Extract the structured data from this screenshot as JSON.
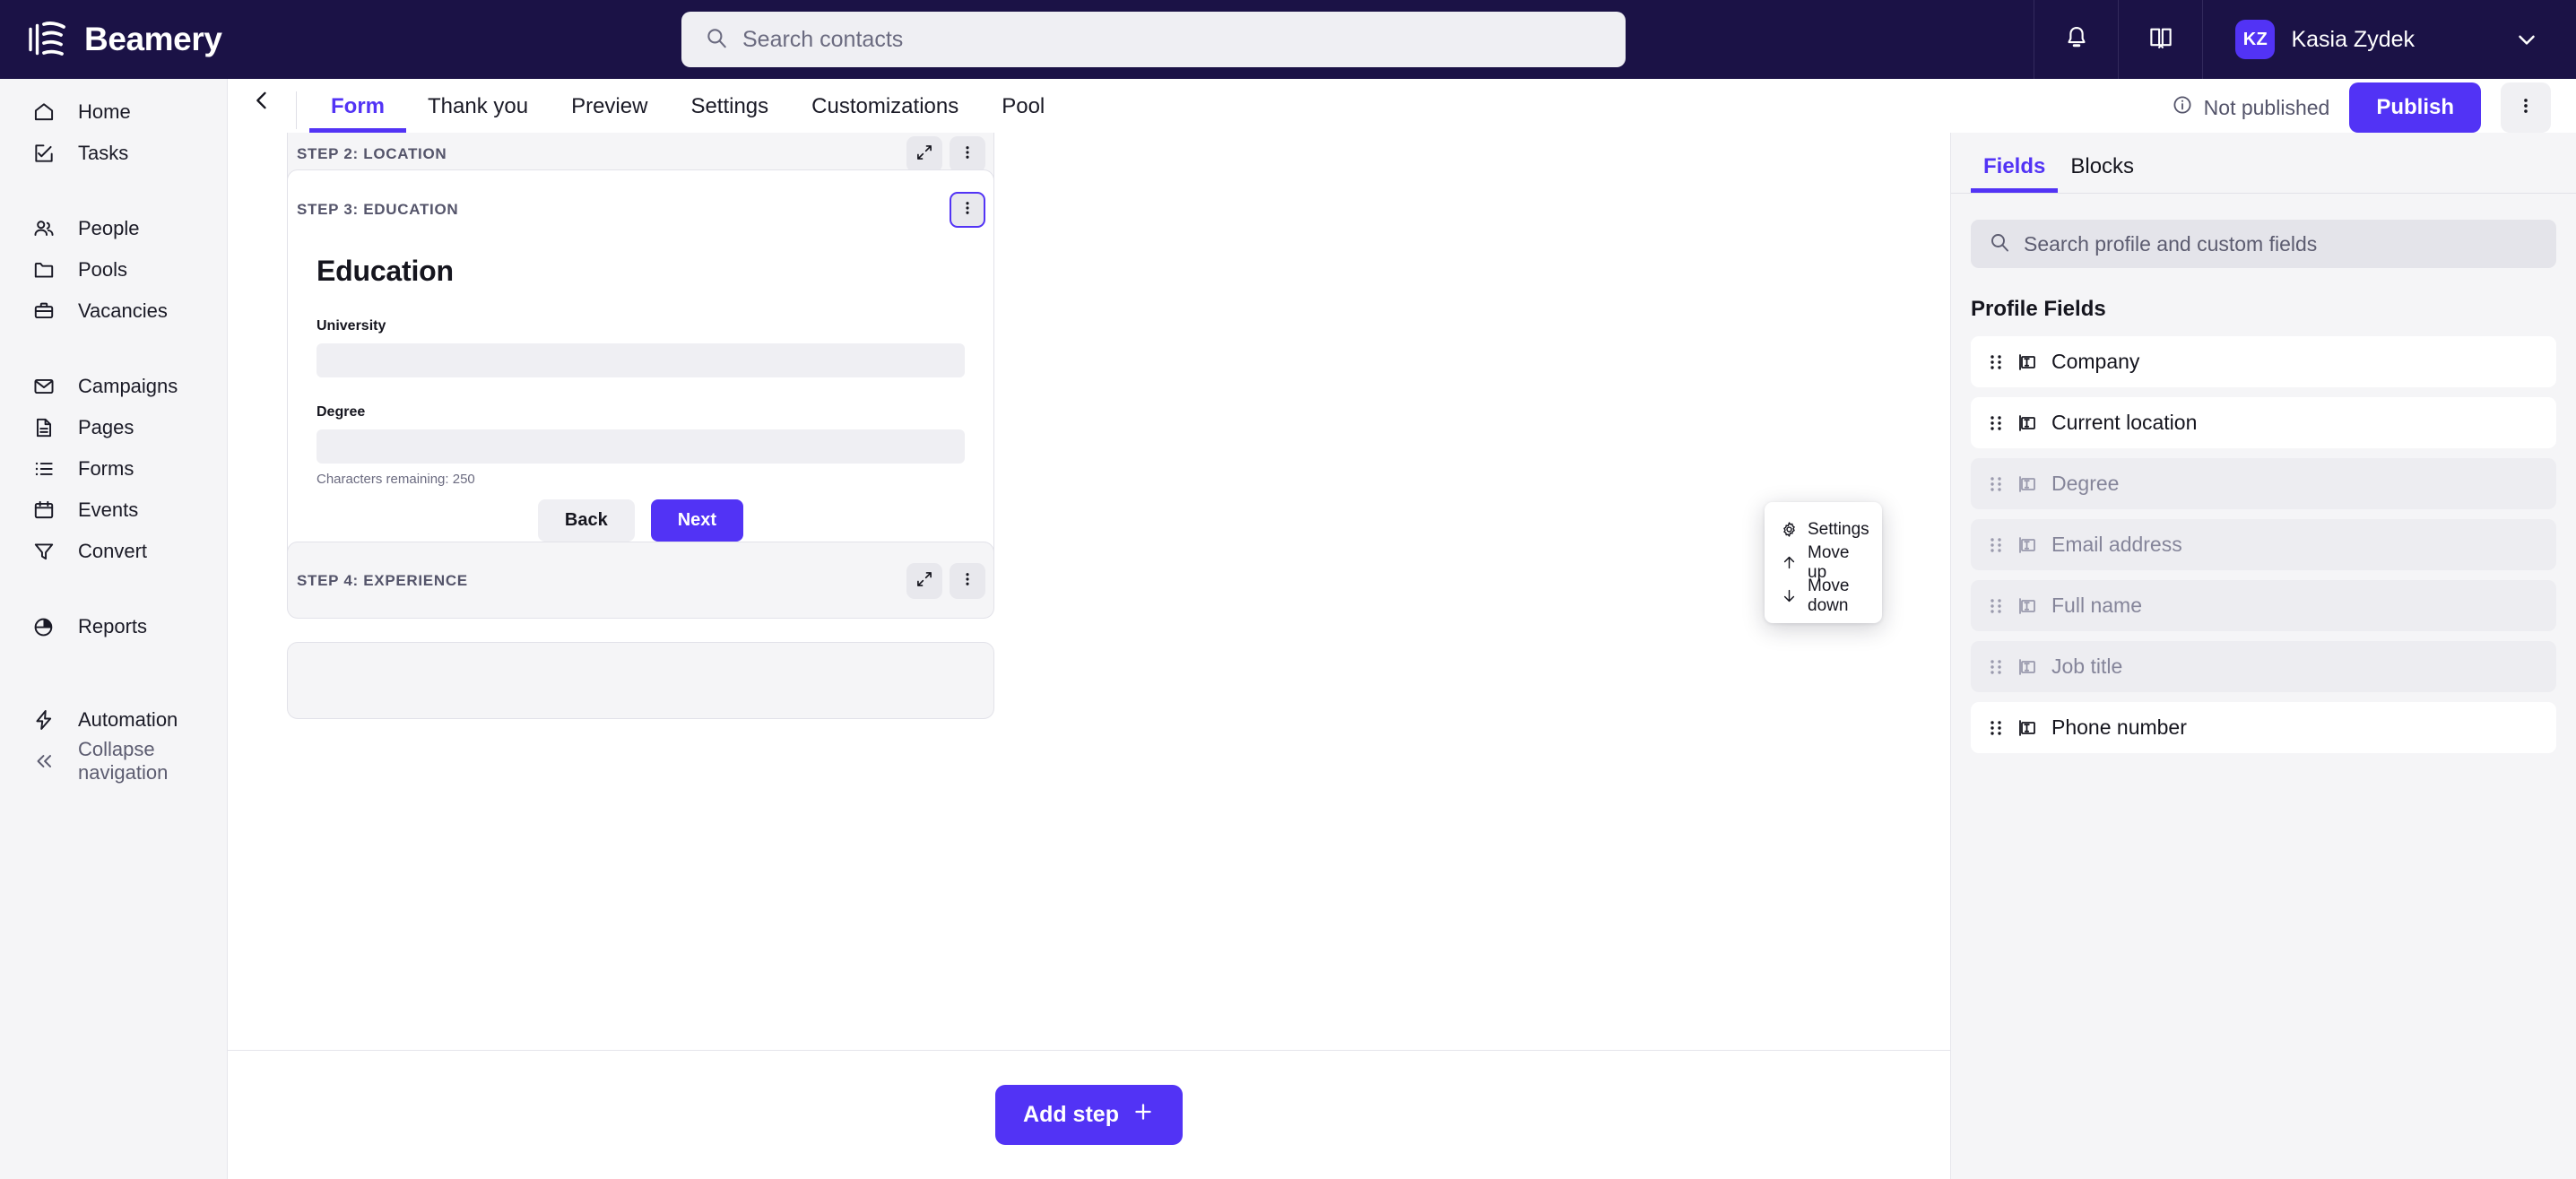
{
  "brand": {
    "name": "Beamery",
    "accent": "#5233F5",
    "topbar_bg": "#1B1246"
  },
  "topbar": {
    "search_placeholder": "Search contacts",
    "notifications_icon": "bell-icon",
    "knowledge_icon": "book-icon",
    "user": {
      "initials": "KZ",
      "name": "Kasia Zydek"
    }
  },
  "sidebar": {
    "groups": [
      {
        "items": [
          {
            "label": "Home",
            "icon": "home-icon"
          },
          {
            "label": "Tasks",
            "icon": "task-check-icon"
          }
        ]
      },
      {
        "items": [
          {
            "label": "People",
            "icon": "people-icon"
          },
          {
            "label": "Pools",
            "icon": "folder-icon"
          },
          {
            "label": "Vacancies",
            "icon": "briefcase-icon"
          }
        ]
      },
      {
        "items": [
          {
            "label": "Campaigns",
            "icon": "envelope-icon"
          },
          {
            "label": "Pages",
            "icon": "document-icon"
          },
          {
            "label": "Forms",
            "icon": "list-icon"
          },
          {
            "label": "Events",
            "icon": "calendar-icon"
          },
          {
            "label": "Convert",
            "icon": "funnel-icon"
          }
        ]
      },
      {
        "items": [
          {
            "label": "Reports",
            "icon": "pie-chart-icon"
          }
        ]
      },
      {
        "items": [
          {
            "label": "Automation",
            "icon": "lightning-icon"
          },
          {
            "label": "Collapse navigation",
            "icon": "double-chevron-left-icon"
          }
        ]
      }
    ]
  },
  "tabbar": {
    "back_icon": "chevron-left-icon",
    "tabs": [
      {
        "label": "Form",
        "active": true
      },
      {
        "label": "Thank you",
        "active": false
      },
      {
        "label": "Preview",
        "active": false
      },
      {
        "label": "Settings",
        "active": false
      },
      {
        "label": "Customizations",
        "active": false
      },
      {
        "label": "Pool",
        "active": false
      }
    ],
    "status_label": "Not published",
    "status_icon": "info-icon",
    "publish_label": "Publish",
    "overflow_icon": "kebab-icon"
  },
  "canvas": {
    "steps": [
      {
        "title": "STEP 2: LOCATION",
        "state": "collapsed",
        "buttons": [
          "expand-icon",
          "kebab-icon"
        ]
      },
      {
        "title": "STEP 3: EDUCATION",
        "state": "expanded",
        "buttons": [
          "kebab-icon"
        ]
      },
      {
        "title": "STEP 4: EXPERIENCE",
        "state": "collapsed",
        "buttons": [
          "expand-icon",
          "kebab-icon"
        ]
      }
    ],
    "education_form": {
      "heading": "Education",
      "fields": [
        {
          "label": "University",
          "value": "",
          "hint": ""
        },
        {
          "label": "Degree",
          "value": "",
          "hint": "Characters remaining: 250"
        }
      ],
      "back_label": "Back",
      "next_label": "Next"
    },
    "step_menu": {
      "items": [
        {
          "label": "Settings",
          "icon": "gear-icon"
        },
        {
          "label": "Move up",
          "icon": "arrow-up-icon"
        },
        {
          "label": "Move down",
          "icon": "arrow-down-icon"
        }
      ]
    },
    "add_step_label": "Add step",
    "add_step_icon": "plus-icon"
  },
  "right_panel": {
    "tabs": [
      {
        "label": "Fields",
        "active": true
      },
      {
        "label": "Blocks",
        "active": false
      }
    ],
    "search_placeholder": "Search profile and custom fields",
    "section_title": "Profile Fields",
    "fields": [
      {
        "label": "Company",
        "icon": "text-field-icon",
        "disabled": false
      },
      {
        "label": "Current location",
        "icon": "text-field-icon",
        "disabled": false
      },
      {
        "label": "Degree",
        "icon": "text-field-icon",
        "disabled": true
      },
      {
        "label": "Email address",
        "icon": "text-field-icon",
        "disabled": true
      },
      {
        "label": "Full name",
        "icon": "text-field-icon",
        "disabled": true
      },
      {
        "label": "Job title",
        "icon": "text-field-icon",
        "disabled": true
      },
      {
        "label": "Phone number",
        "icon": "text-field-icon",
        "disabled": false
      }
    ]
  }
}
